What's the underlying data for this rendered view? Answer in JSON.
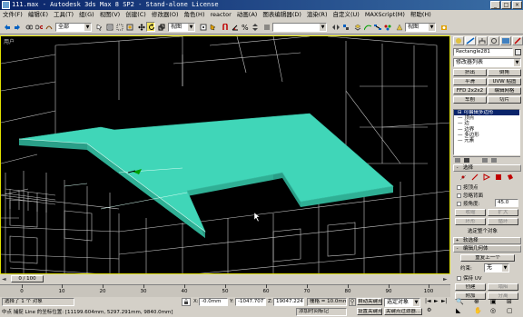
{
  "title": "111.max - Autodesk 3ds Max 8 SP2 - Stand-alone License",
  "window_buttons": [
    "_",
    "□",
    "×"
  ],
  "menu": [
    "文件(F)",
    "编辑(E)",
    "工具(T)",
    "组(G)",
    "视图(V)",
    "创建(C)",
    "修改器(O)",
    "角色(H)",
    "reactor",
    "动画(A)",
    "图表编辑器(D)",
    "渲染(R)",
    "自定义(U)",
    "MAXScript(M)",
    "帮助(H)"
  ],
  "toolbar": {
    "selection_filter": "全部",
    "ref_coord": "视图",
    "named_selection": "",
    "render_type": "视图"
  },
  "viewport": {
    "label": "用户"
  },
  "command_panel": {
    "object_name": "Rectangle281",
    "modifier_list": "修改器列表",
    "buttons": [
      [
        "挤出",
        "倒角"
      ],
      [
        "平滑",
        "UVW 贴图"
      ],
      [
        "FFD 2x2x2",
        "编辑网格"
      ],
      [
        "车削",
        "切片"
      ]
    ],
    "stack": [
      {
        "label": "⊟ 可编辑多边形",
        "selected": true
      },
      {
        "label": "— 顶点",
        "selected": false
      },
      {
        "label": "— 边",
        "selected": false
      },
      {
        "label": "— 边界",
        "selected": false
      },
      {
        "label": "— 多边形",
        "selected": false
      },
      {
        "label": "— 元素",
        "selected": false
      }
    ],
    "selection_rollout": "选择",
    "sel_by_vertex": "按顶点",
    "ignore_backfacing": "忽略背面",
    "by_angle": "按角度:",
    "angle_value": "45.0",
    "shrink": "收缩",
    "grow": "扩大",
    "ring": "环形",
    "loop": "循环",
    "selected_count": "选定整个对象",
    "soft_selection": "软选择",
    "edit_geometry": "编辑几何体",
    "repeat_last": "重复上一个",
    "constraints_label": "约束:",
    "constraints_value": "无",
    "preserve_uvs": "保持 UV",
    "create": "创建",
    "collapse": "塌陷",
    "attach": "附加",
    "detach": "分离"
  },
  "time": {
    "slider": "0 / 100",
    "ticks": [
      "0",
      "10",
      "20",
      "30",
      "40",
      "50",
      "60",
      "70",
      "80",
      "90",
      "100"
    ]
  },
  "status": {
    "selected": "选择了 1 个 对象",
    "prompt": "中点  捕捉 Line 的坐标位置: [11199.604mm, 5297.291mm, 9840.0mm]",
    "x_label": "X:",
    "x_value": "-0.0mm",
    "y_label": "Y:",
    "y_value": "-1047.707",
    "z_label": "Z:",
    "z_value": "19047.224",
    "grid": "栅格 = 10.0mm",
    "add_time_tag": "添加时间标记",
    "auto_key": "自动关键点",
    "set_key": "设置关键点",
    "selected_set": "选定对象",
    "key_filters": "关键点过滤器..."
  },
  "colors": {
    "slab": "#40d6b8",
    "slab_edge": "#2a8f7a",
    "wire": "#e8e8e8",
    "title": "#0a246a"
  }
}
